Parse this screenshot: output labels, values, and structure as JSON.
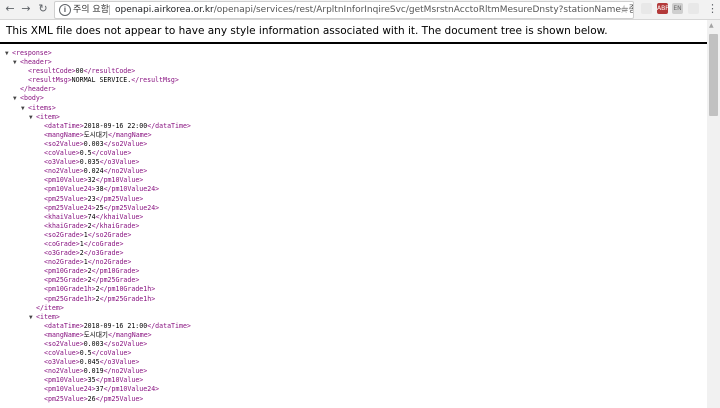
{
  "browser": {
    "security_label": "주의 요함",
    "url_host": "openapi.airkorea.or.kr",
    "url_path": "/openapi/services/rest/ArpltnInforInqireSvc/getMsrstnAcctoRltmMesureDnsty?stationName=종로구&dataTerm=mo...",
    "ext1_label": "ABP",
    "ext2_label": "EN"
  },
  "info_message": "This XML file does not appear to have any style information associated with it. The document tree is shown below.",
  "tree": [
    {
      "indent": 0,
      "toggle": true,
      "open": "<response>",
      "text": "",
      "close": ""
    },
    {
      "indent": 1,
      "toggle": true,
      "open": "<header>",
      "text": "",
      "close": ""
    },
    {
      "indent": 2,
      "toggle": false,
      "open": "<resultCode>",
      "text": "00",
      "close": "</resultCode>"
    },
    {
      "indent": 2,
      "toggle": false,
      "open": "<resultMsg>",
      "text": "NORMAL SERVICE.",
      "close": "</resultMsg>"
    },
    {
      "indent": 1,
      "toggle": false,
      "open": "</header>",
      "text": "",
      "close": ""
    },
    {
      "indent": 1,
      "toggle": true,
      "open": "<body>",
      "text": "",
      "close": ""
    },
    {
      "indent": 2,
      "toggle": true,
      "open": "<items>",
      "text": "",
      "close": ""
    },
    {
      "indent": 3,
      "toggle": true,
      "open": "<item>",
      "text": "",
      "close": ""
    },
    {
      "indent": 4,
      "toggle": false,
      "open": "<dataTime>",
      "text": "2018-09-16 22:00",
      "close": "</dataTime>"
    },
    {
      "indent": 4,
      "toggle": false,
      "open": "<mangName>",
      "text": "도시대기",
      "close": "</mangName>"
    },
    {
      "indent": 4,
      "toggle": false,
      "open": "<so2Value>",
      "text": "0.003",
      "close": "</so2Value>"
    },
    {
      "indent": 4,
      "toggle": false,
      "open": "<coValue>",
      "text": "0.5",
      "close": "</coValue>"
    },
    {
      "indent": 4,
      "toggle": false,
      "open": "<o3Value>",
      "text": "0.035",
      "close": "</o3Value>"
    },
    {
      "indent": 4,
      "toggle": false,
      "open": "<no2Value>",
      "text": "0.024",
      "close": "</no2Value>"
    },
    {
      "indent": 4,
      "toggle": false,
      "open": "<pm10Value>",
      "text": "32",
      "close": "</pm10Value>"
    },
    {
      "indent": 4,
      "toggle": false,
      "open": "<pm10Value24>",
      "text": "38",
      "close": "</pm10Value24>"
    },
    {
      "indent": 4,
      "toggle": false,
      "open": "<pm25Value>",
      "text": "23",
      "close": "</pm25Value>"
    },
    {
      "indent": 4,
      "toggle": false,
      "open": "<pm25Value24>",
      "text": "25",
      "close": "</pm25Value24>"
    },
    {
      "indent": 4,
      "toggle": false,
      "open": "<khaiValue>",
      "text": "74",
      "close": "</khaiValue>"
    },
    {
      "indent": 4,
      "toggle": false,
      "open": "<khaiGrade>",
      "text": "2",
      "close": "</khaiGrade>"
    },
    {
      "indent": 4,
      "toggle": false,
      "open": "<so2Grade>",
      "text": "1",
      "close": "</so2Grade>"
    },
    {
      "indent": 4,
      "toggle": false,
      "open": "<coGrade>",
      "text": "1",
      "close": "</coGrade>"
    },
    {
      "indent": 4,
      "toggle": false,
      "open": "<o3Grade>",
      "text": "2",
      "close": "</o3Grade>"
    },
    {
      "indent": 4,
      "toggle": false,
      "open": "<no2Grade>",
      "text": "1",
      "close": "</no2Grade>"
    },
    {
      "indent": 4,
      "toggle": false,
      "open": "<pm10Grade>",
      "text": "2",
      "close": "</pm10Grade>"
    },
    {
      "indent": 4,
      "toggle": false,
      "open": "<pm25Grade>",
      "text": "2",
      "close": "</pm25Grade>"
    },
    {
      "indent": 4,
      "toggle": false,
      "open": "<pm10Grade1h>",
      "text": "2",
      "close": "</pm10Grade1h>"
    },
    {
      "indent": 4,
      "toggle": false,
      "open": "<pm25Grade1h>",
      "text": "2",
      "close": "</pm25Grade1h>"
    },
    {
      "indent": 3,
      "toggle": false,
      "open": "</item>",
      "text": "",
      "close": ""
    },
    {
      "indent": 3,
      "toggle": true,
      "open": "<item>",
      "text": "",
      "close": ""
    },
    {
      "indent": 4,
      "toggle": false,
      "open": "<dataTime>",
      "text": "2018-09-16 21:00",
      "close": "</dataTime>"
    },
    {
      "indent": 4,
      "toggle": false,
      "open": "<mangName>",
      "text": "도시대기",
      "close": "</mangName>"
    },
    {
      "indent": 4,
      "toggle": false,
      "open": "<so2Value>",
      "text": "0.003",
      "close": "</so2Value>"
    },
    {
      "indent": 4,
      "toggle": false,
      "open": "<coValue>",
      "text": "0.5",
      "close": "</coValue>"
    },
    {
      "indent": 4,
      "toggle": false,
      "open": "<o3Value>",
      "text": "0.045",
      "close": "</o3Value>"
    },
    {
      "indent": 4,
      "toggle": false,
      "open": "<no2Value>",
      "text": "0.019",
      "close": "</no2Value>"
    },
    {
      "indent": 4,
      "toggle": false,
      "open": "<pm10Value>",
      "text": "35",
      "close": "</pm10Value>"
    },
    {
      "indent": 4,
      "toggle": false,
      "open": "<pm10Value24>",
      "text": "37",
      "close": "</pm10Value24>"
    },
    {
      "indent": 4,
      "toggle": false,
      "open": "<pm25Value>",
      "text": "26",
      "close": "</pm25Value>"
    }
  ]
}
